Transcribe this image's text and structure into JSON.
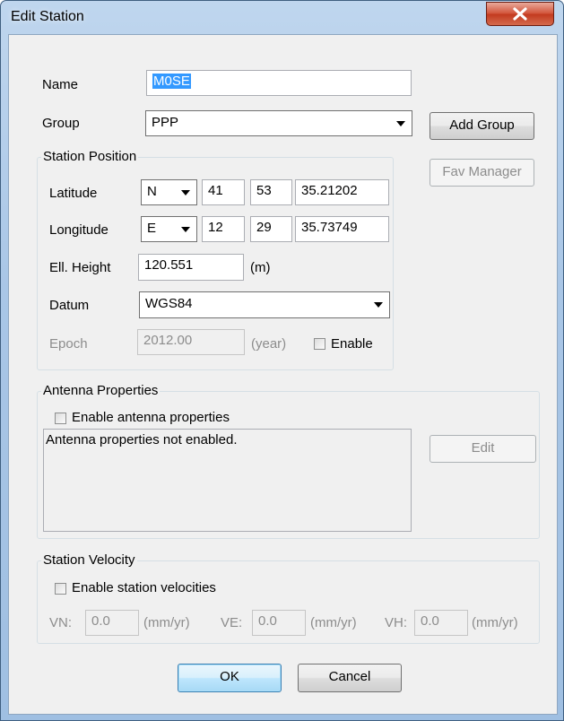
{
  "window": {
    "title": "Edit Station",
    "close_icon": "close-icon"
  },
  "name": {
    "label": "Name",
    "value": "M0SE"
  },
  "group": {
    "label": "Group",
    "value": "PPP",
    "add_button": "Add Group"
  },
  "fav_manager_button": "Fav Manager",
  "station_position": {
    "title": "Station Position",
    "latitude": {
      "label": "Latitude",
      "hemisphere": "N",
      "deg": "41",
      "min": "53",
      "sec": "35.21202"
    },
    "longitude": {
      "label": "Longitude",
      "hemisphere": "E",
      "deg": "12",
      "min": "29",
      "sec": "35.73749"
    },
    "height": {
      "label": "Ell. Height",
      "value": "120.551",
      "unit": "(m)"
    },
    "datum": {
      "label": "Datum",
      "value": "WGS84"
    },
    "epoch": {
      "label": "Epoch",
      "value": "2012.00",
      "unit": "(year)",
      "enable_label": "Enable"
    }
  },
  "antenna": {
    "title": "Antenna Properties",
    "enable_label": "Enable antenna properties",
    "memo_text": "Antenna properties not enabled.",
    "edit_button": "Edit"
  },
  "velocity": {
    "title": "Station Velocity",
    "enable_label": "Enable station velocities",
    "vn_label": "VN:",
    "vn_value": "0.0",
    "ve_label": "VE:",
    "ve_value": "0.0",
    "vh_label": "VH:",
    "vh_value": "0.0",
    "unit": "(mm/yr)"
  },
  "buttons": {
    "ok": "OK",
    "cancel": "Cancel"
  }
}
